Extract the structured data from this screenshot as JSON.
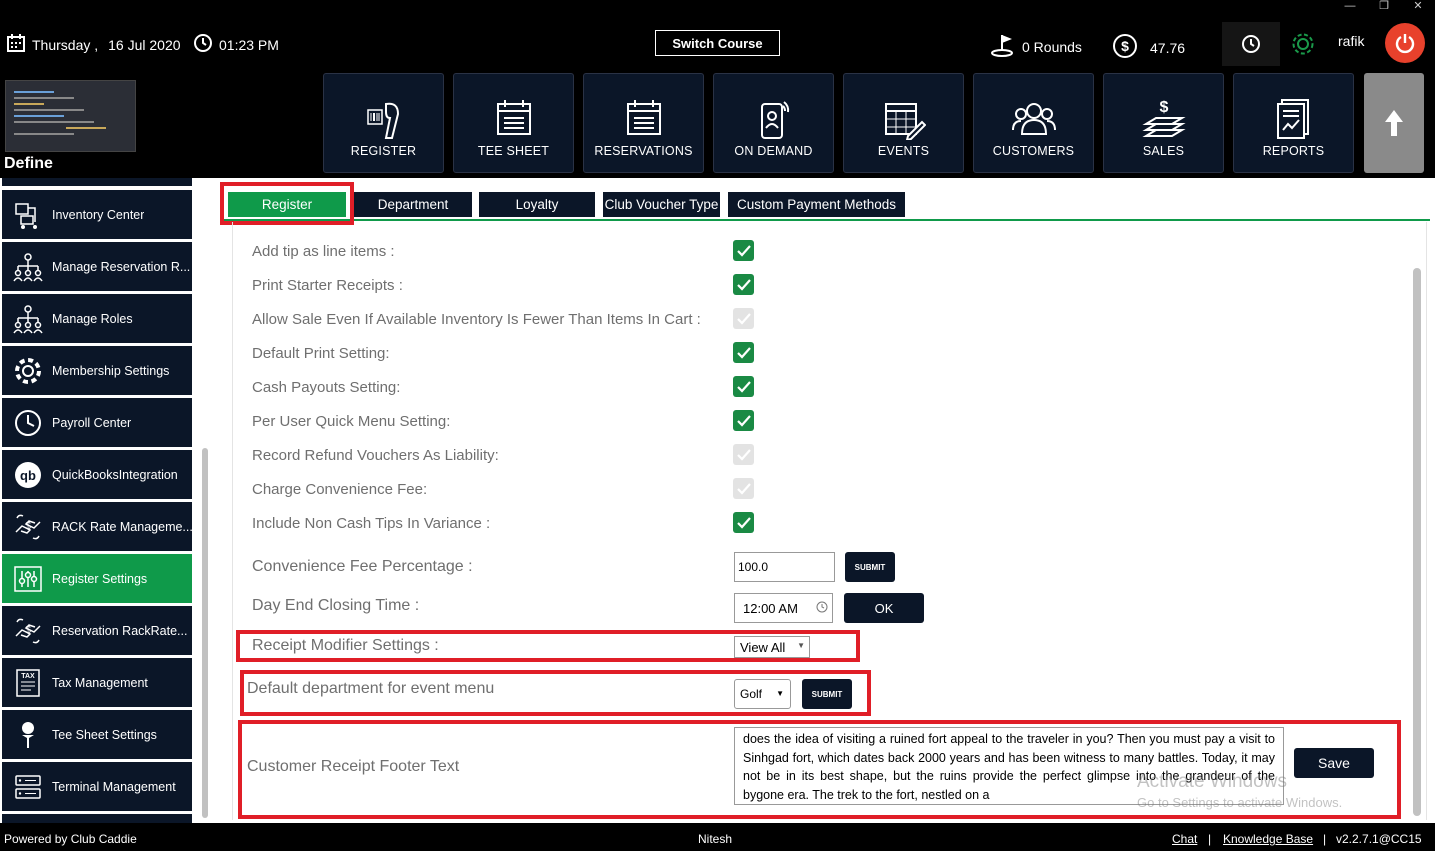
{
  "window_controls": {
    "minimize": "—",
    "restore": "❐",
    "close": "✕"
  },
  "topbar": {
    "day": "Thursday ,",
    "date": "16 Jul 2020",
    "time": "01:23 PM",
    "switch_course": "Switch Course",
    "rounds": "0 Rounds",
    "balance": "47.76",
    "user": "rafik"
  },
  "module_title": "Define",
  "nav": [
    {
      "label": "REGISTER",
      "icon": "barcode-scanner-icon"
    },
    {
      "label": "TEE SHEET",
      "icon": "calendar-list-icon"
    },
    {
      "label": "RESERVATIONS",
      "icon": "calendar-list-icon"
    },
    {
      "label": "ON DEMAND",
      "icon": "mobile-user-icon"
    },
    {
      "label": "EVENTS",
      "icon": "calendar-edit-icon"
    },
    {
      "label": "CUSTOMERS",
      "icon": "users-icon"
    },
    {
      "label": "SALES",
      "icon": "money-stack-icon"
    },
    {
      "label": "REPORTS",
      "icon": "report-icon"
    }
  ],
  "sidebar": [
    {
      "label": "Inventory Center",
      "icon": "inventory-icon"
    },
    {
      "label": "Manage Reservation R...",
      "icon": "hierarchy-icon"
    },
    {
      "label": "Manage Roles",
      "icon": "hierarchy-icon"
    },
    {
      "label": "Membership Settings",
      "icon": "gear-icon"
    },
    {
      "label": "Payroll Center",
      "icon": "clock-icon"
    },
    {
      "label": "QuickBooksIntegration",
      "icon": "quickbooks-icon"
    },
    {
      "label": "RACK Rate Manageme...",
      "icon": "hand-money-icon"
    },
    {
      "label": "Register Settings",
      "icon": "sliders-icon",
      "active": true
    },
    {
      "label": "Reservation RackRate...",
      "icon": "hand-money-icon"
    },
    {
      "label": "Tax Management",
      "icon": "tax-icon"
    },
    {
      "label": "Tee Sheet Settings",
      "icon": "golf-tee-icon"
    },
    {
      "label": "Terminal Management",
      "icon": "server-icon"
    }
  ],
  "tabs": [
    "Register",
    "Department",
    "Loyalty",
    "Club Voucher Type",
    "Custom Payment Methods"
  ],
  "settings": [
    {
      "label": "Add tip as line items :",
      "checked": true
    },
    {
      "label": "Print Starter Receipts :",
      "checked": true
    },
    {
      "label": "Allow Sale Even If Available Inventory Is Fewer Than Items In Cart :",
      "checked": false
    },
    {
      "label": "Default Print Setting:",
      "checked": true
    },
    {
      "label": "Cash Payouts Setting:",
      "checked": true
    },
    {
      "label": "Per User Quick Menu Setting:",
      "checked": true
    },
    {
      "label": "Record Refund Vouchers As Liability:",
      "checked": false
    },
    {
      "label": "Charge Convenience Fee:",
      "checked": false
    },
    {
      "label": "Include Non Cash Tips In Variance :",
      "checked": true
    }
  ],
  "convenience_fee": {
    "label": "Convenience Fee Percentage :",
    "value": "100.0",
    "button": "SUBMIT"
  },
  "day_end": {
    "label": "Day End Closing Time :",
    "value": "12:00 AM",
    "button": "OK"
  },
  "receipt_modifier": {
    "label": "Receipt Modifier Settings :",
    "value": "View All"
  },
  "event_dept": {
    "label": "Default department for event menu",
    "value": "Golf",
    "button": "SUBMIT"
  },
  "footer_text": {
    "label": "Customer Receipt Footer Text",
    "value": "does the idea of visiting a ruined fort appeal to the traveler in you? Then you must pay a visit to Sinhgad fort, which dates back 2000 years and has been witness to many battles. Today, it may not be in its best shape, but the ruins provide the perfect glimpse into the grandeur of the bygone era. The trek to the fort, nestled on a",
    "button": "Save"
  },
  "watermark": {
    "line1": "Activate Windows",
    "line2": "Go to Settings to activate Windows."
  },
  "footer": {
    "powered": "Powered by Club Caddie",
    "user": "Nitesh",
    "chat": "Chat",
    "sep": "|",
    "kb": "Knowledge Base",
    "version": "v2.2.7.1@CC15"
  },
  "colors": {
    "accent": "#0f9a4a",
    "navy": "#0b1628",
    "highlight": "#e01e27",
    "power": "#e8412c"
  }
}
